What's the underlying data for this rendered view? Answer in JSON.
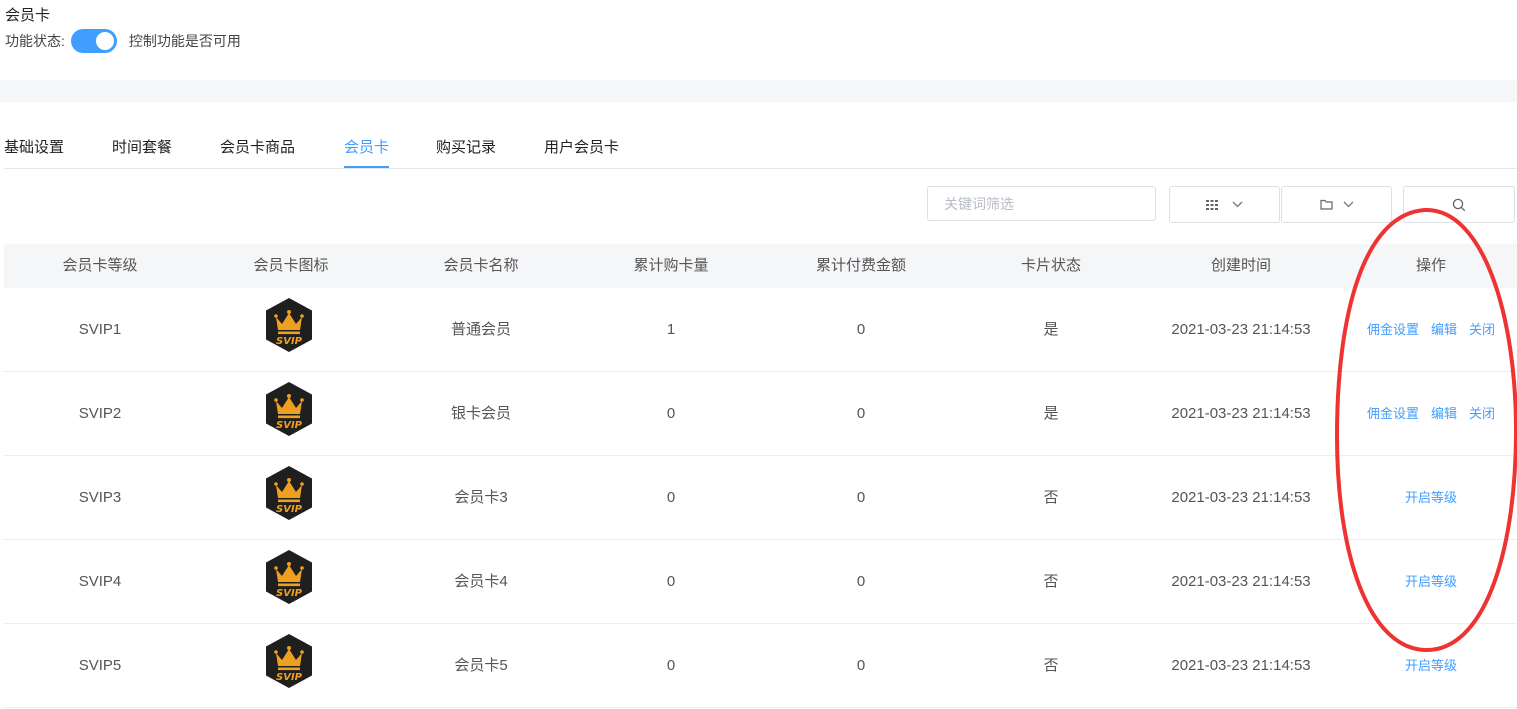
{
  "page": {
    "title": "会员卡"
  },
  "status": {
    "label": "功能状态:",
    "enabled": true,
    "description": "控制功能是否可用"
  },
  "tabs": [
    {
      "label": "基础设置",
      "active": false
    },
    {
      "label": "时间套餐",
      "active": false
    },
    {
      "label": "会员卡商品",
      "active": false
    },
    {
      "label": "会员卡",
      "active": true
    },
    {
      "label": "购买记录",
      "active": false
    },
    {
      "label": "用户会员卡",
      "active": false
    }
  ],
  "toolbar": {
    "search_placeholder": "关键词筛选",
    "grid_icon": "grid-icon",
    "folder_icon": "folder-icon",
    "search_icon": "search-icon"
  },
  "table": {
    "headers": [
      "会员卡等级",
      "会员卡图标",
      "会员卡名称",
      "累计购卡量",
      "累计付费金额",
      "卡片状态",
      "创建时间",
      "操作"
    ],
    "rows": [
      {
        "level": "SVIP1",
        "icon": "svip-badge-icon",
        "name": "普通会员",
        "cards_sold": "1",
        "amount": "0",
        "status": "是",
        "created": "2021-03-23 21:14:53",
        "actions": [
          "佣金设置",
          "编辑",
          "关闭"
        ]
      },
      {
        "level": "SVIP2",
        "icon": "svip-badge-icon",
        "name": "银卡会员",
        "cards_sold": "0",
        "amount": "0",
        "status": "是",
        "created": "2021-03-23 21:14:53",
        "actions": [
          "佣金设置",
          "编辑",
          "关闭"
        ]
      },
      {
        "level": "SVIP3",
        "icon": "svip-badge-icon",
        "name": "会员卡3",
        "cards_sold": "0",
        "amount": "0",
        "status": "否",
        "created": "2021-03-23 21:14:53",
        "actions": [
          "开启等级"
        ]
      },
      {
        "level": "SVIP4",
        "icon": "svip-badge-icon",
        "name": "会员卡4",
        "cards_sold": "0",
        "amount": "0",
        "status": "否",
        "created": "2021-03-23 21:14:53",
        "actions": [
          "开启等级"
        ]
      },
      {
        "level": "SVIP5",
        "icon": "svip-badge-icon",
        "name": "会员卡5",
        "cards_sold": "0",
        "amount": "0",
        "status": "否",
        "created": "2021-03-23 21:14:53",
        "actions": [
          "开启等级"
        ]
      }
    ],
    "badge_text": "SVIP"
  },
  "colors": {
    "accent": "#409eff",
    "annotation": "#ee3333",
    "badge_bg": "#1f1f1f",
    "badge_gold": "#f0a020"
  }
}
